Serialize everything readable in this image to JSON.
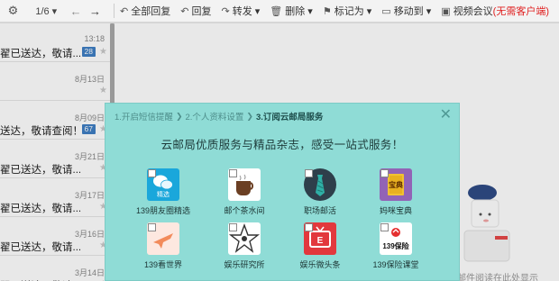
{
  "toolbar": {
    "page": "1/6",
    "buttons": [
      {
        "icon": "reply-all-icon",
        "glyph": "↶",
        "label": "全部回复"
      },
      {
        "icon": "reply-icon",
        "glyph": "↶",
        "label": "回复"
      },
      {
        "icon": "forward-icon",
        "glyph": "↷",
        "label": "转发 ▾"
      },
      {
        "icon": "trash-icon",
        "glyph": "🗑",
        "label": "删除 ▾"
      },
      {
        "icon": "flag-icon",
        "glyph": "⚑",
        "label": "标记为 ▾"
      },
      {
        "icon": "folder-icon",
        "glyph": "▭",
        "label": "移动到 ▾"
      },
      {
        "icon": "video-icon",
        "glyph": "▣",
        "label": "视频会议",
        "extra": "(无需客户端)"
      }
    ]
  },
  "mail_list": [
    {
      "subject": "翟已送达，敬请...",
      "date": "13:18",
      "badge": "28"
    },
    {
      "subject": "",
      "date": "8月13日",
      "badge": ""
    },
    {
      "subject": "送达，敬请查阅！",
      "date": "8月09日",
      "badge": "67"
    },
    {
      "subject": "翟已送达，敬请...",
      "date": "3月21日",
      "badge": ""
    },
    {
      "subject": "翟已送达，敬请...",
      "date": "3月17日",
      "badge": ""
    },
    {
      "subject": "翟已送达，敬请...",
      "date": "3月16日",
      "badge": ""
    },
    {
      "subject": "翟已送达，敬请...",
      "date": "3月14日",
      "badge": ""
    }
  ],
  "mascot_text": "邮件阅读在此处显示",
  "dialog": {
    "steps": [
      "1.开启短信提醒",
      "2.个人资料设置",
      "3.订阅云邮局服务"
    ],
    "title": "云邮局优质服务与精品杂志，感受一站式服务！",
    "items": [
      {
        "label": "139朋友圈精选",
        "icon": "wechat-icon",
        "caption": "精选"
      },
      {
        "label": "邮个茶水间",
        "icon": "coffee-cup-icon",
        "caption": ""
      },
      {
        "label": "职场邮活",
        "icon": "tie-icon",
        "caption": ""
      },
      {
        "label": "妈咪宝典",
        "icon": "book-icon",
        "caption": "宝典"
      },
      {
        "label": "139看世界",
        "icon": "airplane-icon",
        "caption": ""
      },
      {
        "label": "娱乐研究所",
        "icon": "star-icon",
        "caption": ""
      },
      {
        "label": "娱乐微头条",
        "icon": "tv-icon",
        "caption": ""
      },
      {
        "label": "139保险课堂",
        "icon": "insurance-logo-icon",
        "caption": "139保险"
      }
    ]
  }
}
